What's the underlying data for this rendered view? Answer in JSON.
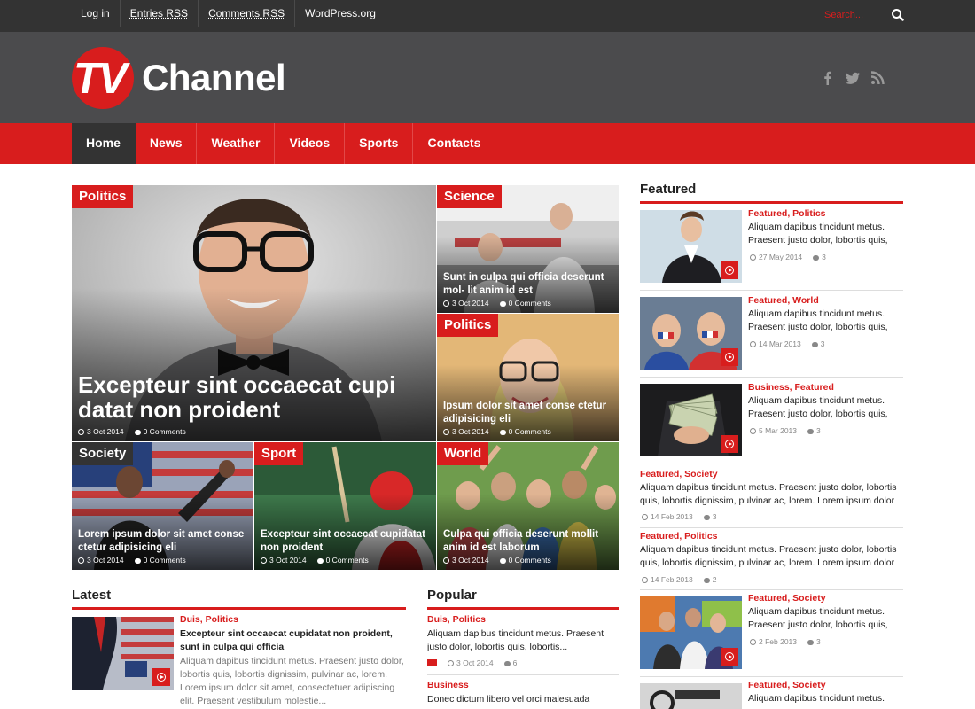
{
  "topbar": {
    "links": [
      "Log in",
      "Entries RSS",
      "Comments RSS",
      "WordPress.org"
    ],
    "search_placeholder": "Search..."
  },
  "header": {
    "logo_mark": "TV",
    "logo_text": "Channel",
    "social": [
      "facebook-icon",
      "twitter-icon",
      "rss-icon"
    ]
  },
  "nav": {
    "items": [
      "Home",
      "News",
      "Weather",
      "Videos",
      "Sports",
      "Contacts"
    ],
    "active": "Home"
  },
  "colors": {
    "accent": "#d81d1d",
    "topbar": "#333333",
    "header": "#4b4b4d"
  },
  "tiles": {
    "main": {
      "category": "Politics",
      "title": "Excepteur sint occaecat cupi datat non proident",
      "date": "3 Oct 2014",
      "comments": "0 Comments"
    },
    "science": {
      "category": "Science",
      "title": "Sunt in culpa qui officia deserunt mol- lit anim id est",
      "date": "3 Oct 2014",
      "comments": "0 Comments"
    },
    "politics2": {
      "category": "Politics",
      "title": "Ipsum dolor sit amet conse ctetur adipisicing eli",
      "date": "3 Oct 2014",
      "comments": "0 Comments"
    },
    "society": {
      "category": "Society",
      "title": "Lorem ipsum dolor sit amet conse ctetur adipisicing eli",
      "date": "3 Oct 2014",
      "comments": "0 Comments"
    },
    "sport": {
      "category": "Sport",
      "title": "Excepteur sint occaecat cupidatat non proident",
      "date": "3 Oct 2014",
      "comments": "0 Comments"
    },
    "world": {
      "category": "World",
      "title": "Culpa qui officia deserunt mollit anim id est laborum",
      "date": "3 Oct 2014",
      "comments": "0 Comments"
    }
  },
  "latest": {
    "heading": "Latest",
    "item": {
      "categories": "Duis, Politics",
      "title": "Excepteur sint occaecat cupidatat non proident, sunt in culpa qui officia",
      "excerpt": "Aliquam dapibus tincidunt metus. Praesent justo dolor, lobortis quis, lobortis dignissim, pulvinar ac, lorem. Lorem ipsum dolor sit amet, consectetuer adipiscing elit. Praesent vestibulum molestie..."
    }
  },
  "popular": {
    "heading": "Popular",
    "items": [
      {
        "categories": "Duis, Politics",
        "excerpt": "Aliquam dapibus tincidunt metus. Praesent justo dolor, lobortis quis, lobortis...",
        "date": "3 Oct 2014",
        "comments": "6"
      },
      {
        "categories": "Business",
        "excerpt": "Donec dictum libero vel orci malesuada"
      }
    ]
  },
  "featured": {
    "heading": "Featured",
    "items": [
      {
        "categories": "Featured, Politics",
        "text": "Aliquam dapibus tincidunt metus. Praesent justo dolor, lobortis quis,",
        "date": "27 May 2014",
        "comments": "3"
      },
      {
        "categories": "Featured, World",
        "text": "Aliquam dapibus tincidunt metus. Praesent justo dolor, lobortis quis,",
        "date": "14 Mar 2013",
        "comments": "3"
      },
      {
        "categories": "Business, Featured",
        "text": "Aliquam dapibus tincidunt metus. Praesent justo dolor, lobortis quis,",
        "date": "5 Mar 2013",
        "comments": "3"
      },
      {
        "categories": "Featured, Society",
        "text": "Aliquam dapibus tincidunt metus. Praesent justo dolor, lobortis quis, lobortis dignissim, pulvinar ac, lorem. Lorem ipsum dolor",
        "date": "14 Feb 2013",
        "comments": "3"
      },
      {
        "categories": "Featured, Politics",
        "text": "Aliquam dapibus tincidunt metus. Praesent justo dolor, lobortis quis, lobortis dignissim, pulvinar ac, lorem. Lorem ipsum dolor",
        "date": "14 Feb 2013",
        "comments": "2"
      },
      {
        "categories": "Featured, Society",
        "text": "Aliquam dapibus tincidunt metus. Praesent justo dolor, lobortis quis,",
        "date": "2 Feb 2013",
        "comments": "3"
      },
      {
        "categories": "Featured, Society",
        "text": "Aliquam dapibus tincidunt metus."
      }
    ]
  }
}
